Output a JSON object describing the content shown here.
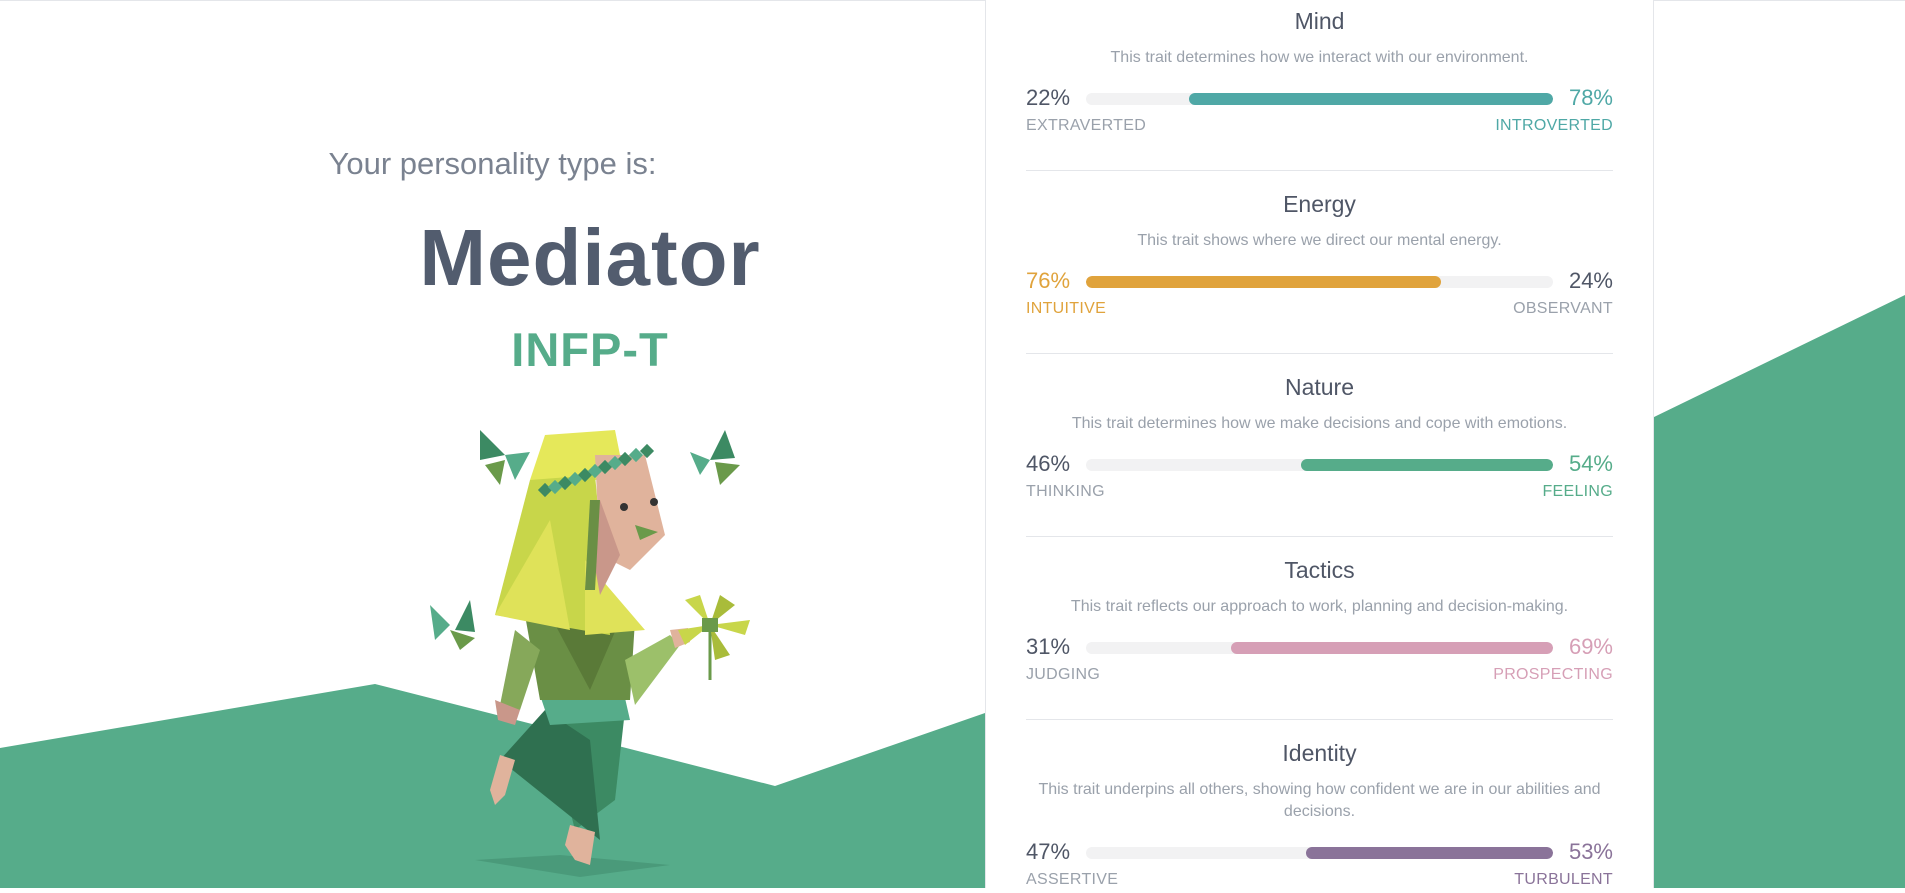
{
  "intro": "Your personality type is:",
  "type_name": "Mediator",
  "type_code": "INFP-T",
  "figure_icon": "mediator-character-illustration",
  "colors": {
    "green": "#56ac8a",
    "teal": "#4fa8a6",
    "gold": "#e0a33c",
    "pink": "#d69fb6",
    "purple": "#8a7399",
    "text": "#525c6e",
    "muted": "#9aa1ab"
  },
  "traits": [
    {
      "title": "Mind",
      "desc": "This trait determines how we interact with our environment.",
      "left_pct": "22%",
      "right_pct": "78%",
      "left_label": "EXTRAVERTED",
      "right_label": "INTROVERTED",
      "dominant": "right",
      "fill_fraction": 0.78,
      "color": "#4fa8a6"
    },
    {
      "title": "Energy",
      "desc": "This trait shows where we direct our mental energy.",
      "left_pct": "76%",
      "right_pct": "24%",
      "left_label": "INTUITIVE",
      "right_label": "OBSERVANT",
      "dominant": "left",
      "fill_fraction": 0.76,
      "color": "#e0a33c"
    },
    {
      "title": "Nature",
      "desc": "This trait determines how we make decisions and cope with emotions.",
      "left_pct": "46%",
      "right_pct": "54%",
      "left_label": "THINKING",
      "right_label": "FEELING",
      "dominant": "right",
      "fill_fraction": 0.54,
      "color": "#56ac8a"
    },
    {
      "title": "Tactics",
      "desc": "This trait reflects our approach to work, planning and decision-making.",
      "left_pct": "31%",
      "right_pct": "69%",
      "left_label": "JUDGING",
      "right_label": "PROSPECTING",
      "dominant": "right",
      "fill_fraction": 0.69,
      "color": "#d69fb6"
    },
    {
      "title": "Identity",
      "desc": "This trait underpins all others, showing how confident we are in our abilities and decisions.",
      "left_pct": "47%",
      "right_pct": "53%",
      "left_label": "ASSERTIVE",
      "right_label": "TURBULENT",
      "dominant": "right",
      "fill_fraction": 0.53,
      "color": "#8a7399"
    }
  ]
}
